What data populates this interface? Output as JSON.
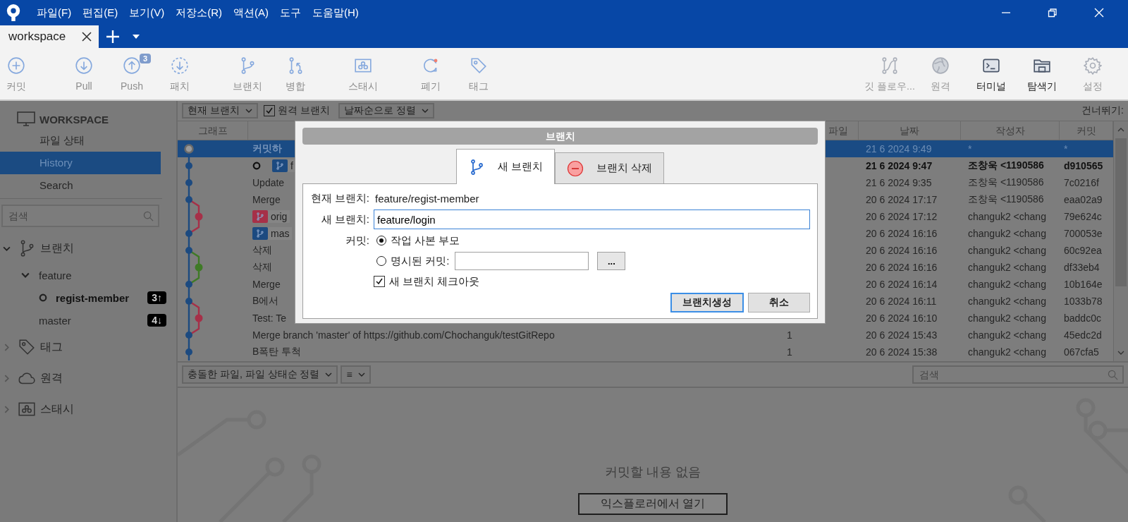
{
  "title_bar": {
    "menu": [
      "파일(F)",
      "편집(E)",
      "보기(V)",
      "저장소(R)",
      "액션(A)",
      "도구",
      "도움말(H)"
    ]
  },
  "tabs": [
    {
      "label": "workspace",
      "selected": true
    }
  ],
  "toolbar": {
    "left": [
      [
        {
          "kind": "commit",
          "label": "커밋",
          "disabled": true
        }
      ],
      [
        {
          "kind": "pull",
          "label": "Pull",
          "disabled": true
        },
        {
          "kind": "push",
          "label": "Push",
          "disabled": true,
          "badge": "3"
        },
        {
          "kind": "patch",
          "label": "패치",
          "disabled": true
        }
      ],
      [
        {
          "kind": "branch",
          "label": "브랜치",
          "disabled": true
        },
        {
          "kind": "merge",
          "label": "병합",
          "disabled": true
        }
      ],
      [
        {
          "kind": "stash",
          "label": "스태시",
          "disabled": true
        }
      ],
      [
        {
          "kind": "discard",
          "label": "폐기",
          "disabled": true
        },
        {
          "kind": "tag",
          "label": "태그",
          "disabled": true
        }
      ]
    ],
    "right": [
      {
        "kind": "gitflow",
        "label": "깃 플로우...",
        "disabled": true
      },
      {
        "kind": "remote",
        "label": "원격",
        "disabled": true
      },
      {
        "kind": "terminal",
        "label": "터미널",
        "disabled": false
      },
      {
        "kind": "explorer",
        "label": "탐색기",
        "disabled": false
      },
      {
        "kind": "settings",
        "label": "설정",
        "disabled": true
      }
    ]
  },
  "sidebar": {
    "header": "WORKSPACE",
    "views": [
      {
        "label": "파일 상태",
        "selected": false
      },
      {
        "label": "History",
        "selected": true
      },
      {
        "label": "Search",
        "selected": false
      }
    ],
    "search": {
      "placeholder": "검색"
    },
    "sections": [
      {
        "kind": "branches",
        "label": "브랜치",
        "expanded": true,
        "children": [
          {
            "label": "feature",
            "expanded": true,
            "children": [
              {
                "label": "regist-member",
                "current": true,
                "badge": "3↑"
              }
            ]
          },
          {
            "label": "master",
            "current": false,
            "badge": "4↓"
          }
        ]
      },
      {
        "kind": "tags",
        "label": "태그",
        "expanded": false
      },
      {
        "kind": "remotes",
        "label": "원격",
        "expanded": false
      },
      {
        "kind": "stashes",
        "label": "스태시",
        "expanded": false
      }
    ]
  },
  "filter_bar": {
    "branch_filter": "현재 브랜치",
    "remote_branches": {
      "label": "원격 브랜치",
      "checked": true
    },
    "sort": "날짜순으로 정렬",
    "jump_label": "건너뛰기:"
  },
  "table": {
    "columns": {
      "graph": "그래프",
      "files": "파일",
      "date": "날짜",
      "author": "작성자",
      "commit": "커밋"
    },
    "rows": [
      {
        "kind": "working",
        "selected": true,
        "current": false,
        "subject": "커밋하",
        "date": "21 6 2024 9:49",
        "author": "*",
        "commit": "*"
      },
      {
        "kind": "commit",
        "selected": false,
        "current": true,
        "tag": {
          "label": "f",
          "color": "#1c4a80"
        },
        "date": "21 6 2024 9:47",
        "author": "조창욱 <1190586",
        "commit": "d910565"
      },
      {
        "kind": "commit",
        "selected": false,
        "current": false,
        "subject": "Update",
        "date": "21 6 2024 9:35",
        "author": "조창욱 <1190586",
        "commit": "7c0216f"
      },
      {
        "kind": "commit",
        "selected": false,
        "current": false,
        "subject": "Merge",
        "date": "20 6 2024 17:17",
        "author": "조창욱 <1190586",
        "commit": "eaa02a9"
      },
      {
        "kind": "side_commit",
        "color": "#a63048",
        "selected": false,
        "current": false,
        "tag": {
          "label": "orig",
          "color": "#a63048"
        },
        "date": "20 6 2024 17:12",
        "author": "changuk2 <chang",
        "commit": "79e624c"
      },
      {
        "kind": "commit",
        "selected": false,
        "current": false,
        "tag": {
          "label": "mas",
          "color": "#1c4a80"
        },
        "date": "20 6 2024 16:16",
        "author": "changuk2 <chang",
        "commit": "700053e"
      },
      {
        "kind": "commit",
        "selected": false,
        "current": false,
        "subject": "삭제",
        "date": "20 6 2024 16:16",
        "author": "changuk2 <chang",
        "commit": "60c92ea"
      },
      {
        "kind": "side_commit",
        "color": "#3f7a26",
        "selected": false,
        "current": false,
        "subject": "삭제",
        "date": "20 6 2024 16:16",
        "author": "changuk2 <chang",
        "commit": "df33eb4"
      },
      {
        "kind": "commit",
        "selected": false,
        "current": false,
        "subject": "Merge",
        "date": "20 6 2024 16:14",
        "author": "changuk2 <chang",
        "commit": "10b164e"
      },
      {
        "kind": "commit",
        "selected": false,
        "current": false,
        "subject": "B에서",
        "date": "20 6 2024 16:11",
        "author": "changuk2 <chang",
        "commit": "1033b78"
      },
      {
        "kind": "side_commit",
        "color": "#a63048",
        "selected": false,
        "current": false,
        "subject": "Test: Te",
        "date": "20 6 2024 16:10",
        "author": "changuk2 <chang",
        "commit": "baddc0c"
      },
      {
        "kind": "commit",
        "selected": false,
        "current": false,
        "subject": "Merge branch 'master' of https://github.com/Chochanguk/testGitRepo",
        "files": "1",
        "date": "20 6 2024 15:43",
        "author": "changuk2 <chang",
        "commit": "45edc2d"
      },
      {
        "kind": "commit",
        "selected": false,
        "current": false,
        "subject": "B폭탄 투척",
        "files": "1",
        "date": "20 6 2024 15:38",
        "author": "changuk2 <chang",
        "commit": "067cfa5"
      }
    ]
  },
  "bottom_panel": {
    "sort": "충돌한 파일, 파일 상태순 정렬",
    "view_button": "≡",
    "search": {
      "placeholder": "검색"
    },
    "empty_message": "커밋할 내용 없음",
    "open_button": "익스플로러에서 열기"
  },
  "dialog": {
    "title": "브랜치",
    "tabs": [
      {
        "kind": "new",
        "label": "새 브랜치",
        "selected": true
      },
      {
        "kind": "delete",
        "label": "브랜치 삭제",
        "selected": false
      }
    ],
    "current_branch_label": "현재 브랜치:",
    "current_branch": "feature/regist-member",
    "new_branch_label": "새 브랜치:",
    "new_branch_value": "feature/login",
    "commit_label": "커밋:",
    "commit_options": [
      {
        "label": "작업 사본 부모",
        "selected": true
      },
      {
        "label": "명시된 커밋:",
        "selected": false
      }
    ],
    "browse_button": "...",
    "checkout": {
      "label": "새 브랜치 체크아웃",
      "checked": true
    },
    "buttons": [
      {
        "label": "브랜치생성",
        "primary": true
      },
      {
        "label": "취소",
        "primary": false
      }
    ]
  }
}
